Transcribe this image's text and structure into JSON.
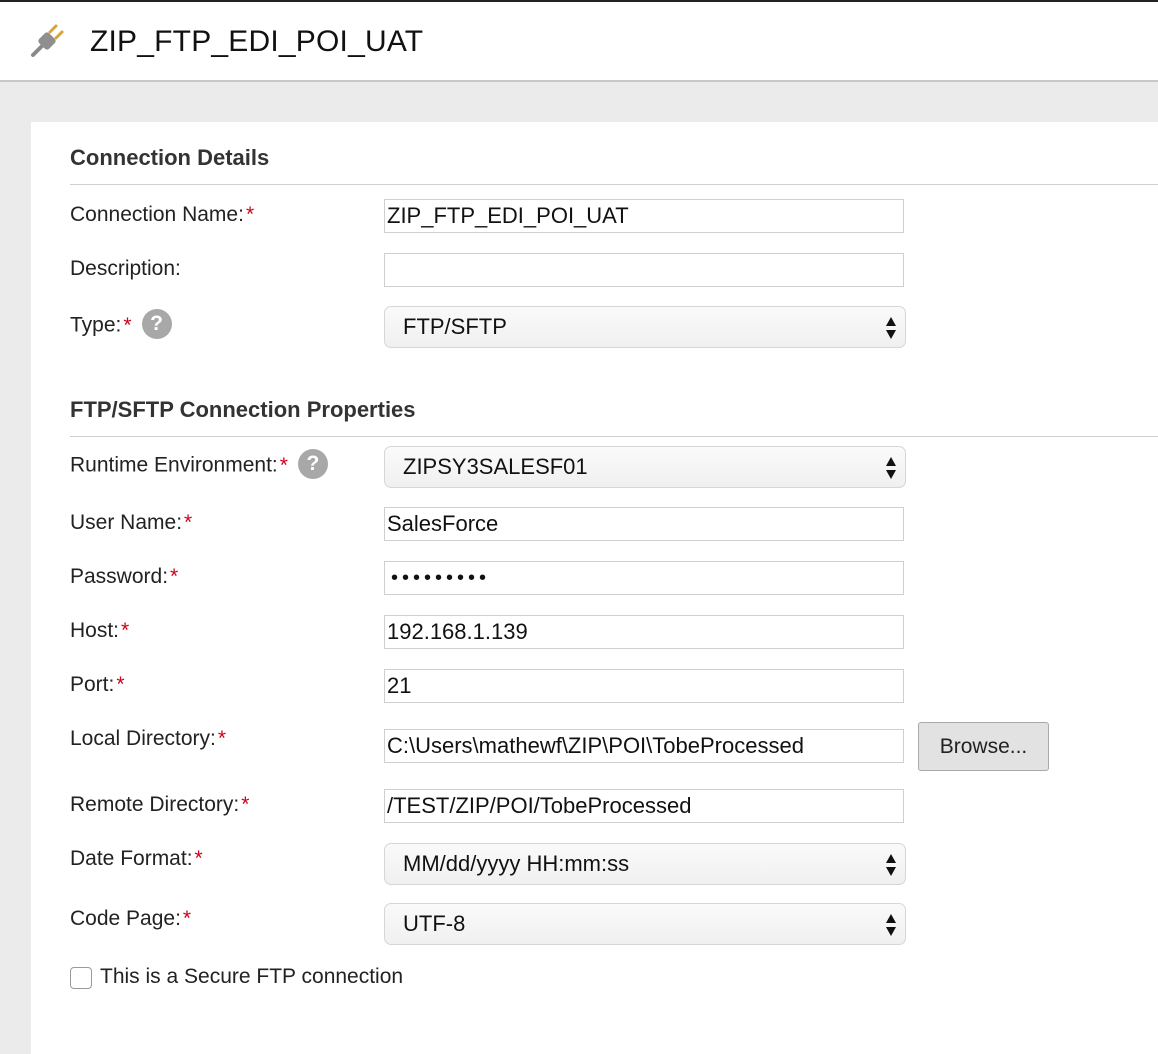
{
  "header": {
    "title": "ZIP_FTP_EDI_POI_UAT",
    "icon": "plug-icon"
  },
  "sections": {
    "connection_details": "Connection Details",
    "ftp_properties": "FTP/SFTP Connection Properties"
  },
  "fields": {
    "connection_name": {
      "label": "Connection Name:",
      "required": "*",
      "value": "ZIP_FTP_EDI_POI_UAT"
    },
    "description": {
      "label": "Description:",
      "value": ""
    },
    "type": {
      "label": "Type:",
      "required": "*",
      "value": "FTP/SFTP",
      "help": "?"
    },
    "runtime_environment": {
      "label": "Runtime Environment:",
      "required": "*",
      "value": "ZIPSY3SALESF01",
      "help": "?"
    },
    "user_name": {
      "label": "User Name:",
      "required": "*",
      "value": "SalesForce"
    },
    "password": {
      "label": "Password:",
      "required": "*",
      "value": "•••••••••"
    },
    "host": {
      "label": "Host:",
      "required": "*",
      "value": "192.168.1.139"
    },
    "port": {
      "label": "Port:",
      "required": "*",
      "value": "21"
    },
    "local_directory": {
      "label": "Local Directory:",
      "required": "*",
      "value": "C:\\Users\\mathewf\\ZIP\\POI\\TobeProcessed",
      "browse_label": "Browse..."
    },
    "remote_directory": {
      "label": "Remote Directory:",
      "required": "*",
      "value": "/TEST/ZIP/POI/TobeProcessed"
    },
    "date_format": {
      "label": "Date Format:",
      "required": "*",
      "value": "MM/dd/yyyy HH:mm:ss"
    },
    "code_page": {
      "label": "Code Page:",
      "required": "*",
      "value": "UTF-8"
    }
  },
  "secure_ftp": {
    "label": "This is a Secure FTP connection",
    "checked": false
  },
  "colors": {
    "required": "#d0021b",
    "help_bg": "#a8a8a8",
    "background": "#ebebeb"
  }
}
